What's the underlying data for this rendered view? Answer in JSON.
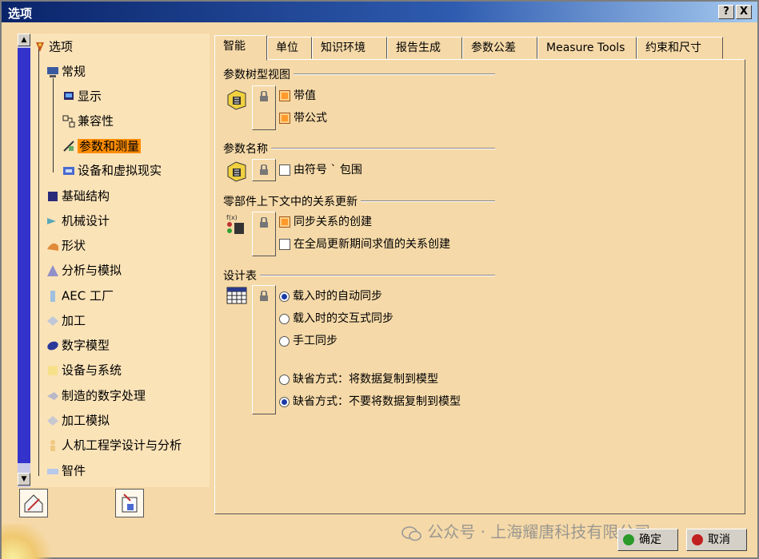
{
  "window": {
    "title": "选项",
    "help_button": "?",
    "close_button": "X"
  },
  "tree": {
    "root": "选项",
    "children": [
      {
        "label": "常规",
        "icon": "computer-icon"
      },
      {
        "label": "显示",
        "icon": "display-icon"
      },
      {
        "label": "兼容性",
        "icon": "compat-icon"
      },
      {
        "label": "参数和测量",
        "icon": "parameters-icon",
        "selected": true
      },
      {
        "label": "设备和虚拟现实",
        "icon": "device-icon"
      }
    ],
    "groups": [
      {
        "label": "基础结构",
        "icon": "infrastructure-icon"
      },
      {
        "label": "机械设计",
        "icon": "mechanical-icon"
      },
      {
        "label": "形状",
        "icon": "shape-icon"
      },
      {
        "label": "分析与模拟",
        "icon": "analysis-icon"
      },
      {
        "label": "AEC 工厂",
        "icon": "aec-icon"
      },
      {
        "label": "加工",
        "icon": "machining-icon"
      },
      {
        "label": "数字模型",
        "icon": "digital-mockup-icon"
      },
      {
        "label": "设备与系统",
        "icon": "equipment-icon"
      },
      {
        "label": "制造的数字处理",
        "icon": "manufacturing-icon"
      },
      {
        "label": "加工模拟",
        "icon": "machining-sim-icon"
      },
      {
        "label": "人机工程学设计与分析",
        "icon": "ergonomics-icon"
      },
      {
        "label": "智件",
        "icon": "smartware-icon"
      }
    ]
  },
  "tabs": [
    "智能",
    "单位",
    "知识环境",
    "报告生成",
    "参数公差",
    "Measure Tools",
    "约束和尺寸"
  ],
  "active_tab": "智能",
  "sections": {
    "param_tree_view": {
      "title": "参数树型视图",
      "options": [
        {
          "label": "带值",
          "checked": true
        },
        {
          "label": "带公式",
          "checked": true
        }
      ]
    },
    "param_name": {
      "title": "参数名称",
      "options": [
        {
          "label": "由符号 ` 包围",
          "checked": false
        }
      ]
    },
    "relations_update": {
      "title": "零部件上下文中的关系更新",
      "options": [
        {
          "label": "同步关系的创建",
          "checked": true
        },
        {
          "label": "在全局更新期间求值的关系创建",
          "checked": false
        }
      ]
    },
    "design_table": {
      "title": "设计表",
      "radios": [
        {
          "label": "载入时的自动同步",
          "selected": true
        },
        {
          "label": "载入时的交互式同步",
          "selected": false
        },
        {
          "label": "手工同步",
          "selected": false
        }
      ],
      "radios2": [
        {
          "label": "缺省方式：将数据复制到模型",
          "selected": false
        },
        {
          "label": "缺省方式：不要将数据复制到模型",
          "selected": true
        }
      ]
    }
  },
  "footer": {
    "ok_label": "确定",
    "cancel_label": "取消"
  },
  "watermark": "公众号 · 上海耀唐科技有限公司",
  "colors": {
    "panel": "#f5d9a8",
    "selected": "#ff8c00",
    "titlebar": "#0a246a",
    "scroll_thumb": "#3333cc"
  }
}
